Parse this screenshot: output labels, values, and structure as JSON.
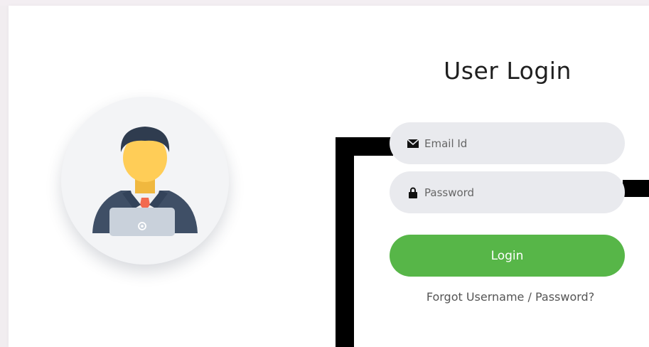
{
  "login": {
    "title": "User Login",
    "email_placeholder": "Email Id",
    "password_placeholder": "Password",
    "login_label": "Login",
    "forgot_link": "Forgot Username / Password?"
  },
  "icons": {
    "avatar": "user-avatar-icon",
    "email": "envelope-icon",
    "password": "lock-icon"
  },
  "colors": {
    "accent": "#57b648",
    "field_bg": "#e9eaee",
    "avatar_circle": "#f3f4f6"
  }
}
